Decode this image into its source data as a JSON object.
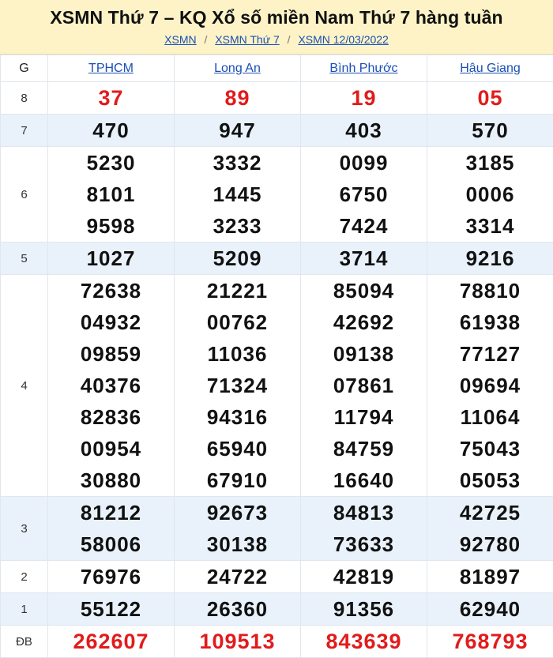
{
  "header": {
    "title": "XSMN Thứ 7 – KQ Xổ số miền Nam Thứ 7 hàng tuần",
    "breadcrumb": [
      "XSMN",
      "XSMN Thứ 7",
      "XSMN 12/03/2022"
    ],
    "separator": "/"
  },
  "table": {
    "label_header": "G",
    "provinces": [
      "TPHCM",
      "Long An",
      "Bình Phước",
      "Hậu Giang"
    ],
    "highlight_color": "#e21b1b",
    "rows": [
      {
        "label": "8",
        "alt": false,
        "red": true,
        "values": [
          [
            "37"
          ],
          [
            "89"
          ],
          [
            "19"
          ],
          [
            "05"
          ]
        ]
      },
      {
        "label": "7",
        "alt": true,
        "red": false,
        "values": [
          [
            "470"
          ],
          [
            "947"
          ],
          [
            "403"
          ],
          [
            "570"
          ]
        ]
      },
      {
        "label": "6",
        "alt": false,
        "red": false,
        "values": [
          [
            "5230",
            "8101",
            "9598"
          ],
          [
            "3332",
            "1445",
            "3233"
          ],
          [
            "0099",
            "6750",
            "7424"
          ],
          [
            "3185",
            "0006",
            "3314"
          ]
        ]
      },
      {
        "label": "5",
        "alt": true,
        "red": false,
        "values": [
          [
            "1027"
          ],
          [
            "5209"
          ],
          [
            "3714"
          ],
          [
            "9216"
          ]
        ]
      },
      {
        "label": "4",
        "alt": false,
        "red": false,
        "values": [
          [
            "72638",
            "04932",
            "09859",
            "40376",
            "82836",
            "00954",
            "30880"
          ],
          [
            "21221",
            "00762",
            "11036",
            "71324",
            "94316",
            "65940",
            "67910"
          ],
          [
            "85094",
            "42692",
            "09138",
            "07861",
            "11794",
            "84759",
            "16640"
          ],
          [
            "78810",
            "61938",
            "77127",
            "09694",
            "11064",
            "75043",
            "05053"
          ]
        ]
      },
      {
        "label": "3",
        "alt": true,
        "red": false,
        "values": [
          [
            "81212",
            "58006"
          ],
          [
            "92673",
            "30138"
          ],
          [
            "84813",
            "73633"
          ],
          [
            "42725",
            "92780"
          ]
        ]
      },
      {
        "label": "2",
        "alt": false,
        "red": false,
        "values": [
          [
            "76976"
          ],
          [
            "24722"
          ],
          [
            "42819"
          ],
          [
            "81897"
          ]
        ]
      },
      {
        "label": "1",
        "alt": true,
        "red": false,
        "values": [
          [
            "55122"
          ],
          [
            "26360"
          ],
          [
            "91356"
          ],
          [
            "62940"
          ]
        ]
      },
      {
        "label": "ĐB",
        "alt": false,
        "red": true,
        "values": [
          [
            "262607"
          ],
          [
            "109513"
          ],
          [
            "843639"
          ],
          [
            "768793"
          ]
        ]
      }
    ]
  }
}
